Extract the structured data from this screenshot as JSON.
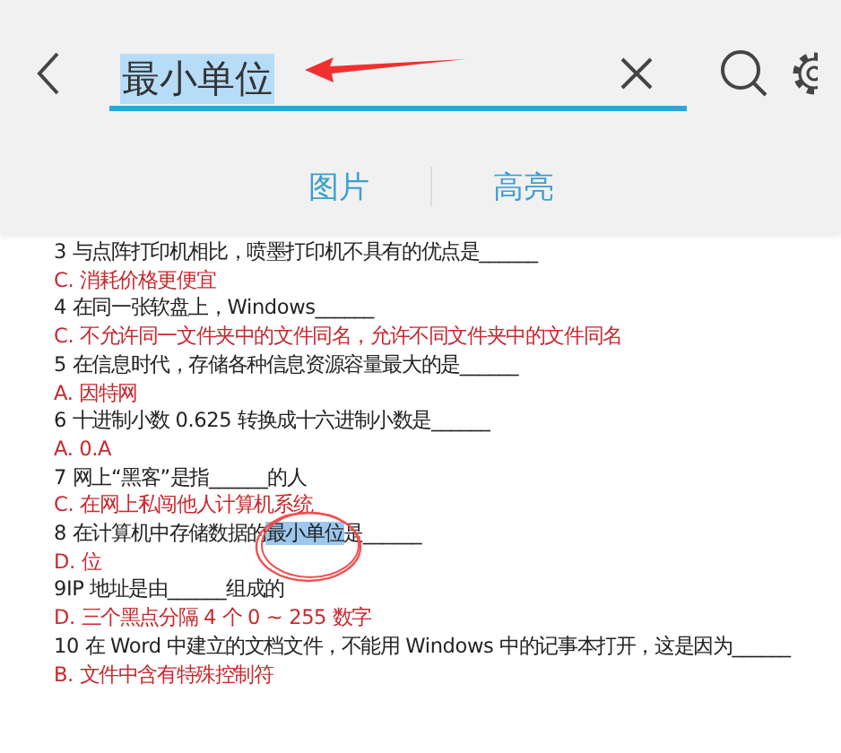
{
  "search": {
    "value": "最小单位",
    "selected_text": true
  },
  "tabs": [
    {
      "label": "图片",
      "selected": false
    },
    {
      "label": "高亮",
      "selected": false
    }
  ],
  "lines": [
    {
      "kind": "question",
      "parts": [
        {
          "text": "3 与点阵打印机相比，喷墨打印机不具有的优点是______",
          "highlighted": false
        }
      ]
    },
    {
      "kind": "answer",
      "parts": [
        {
          "text": "C. 消耗价格更便宜",
          "highlighted": false
        }
      ]
    },
    {
      "kind": "question",
      "parts": [
        {
          "text": "4 在同一张软盘上，Windows______",
          "highlighted": false
        }
      ]
    },
    {
      "kind": "answer",
      "parts": [
        {
          "text": "C. 不允许同一文件夹中的文件同名，允许不同文件夹中的文件同名",
          "highlighted": false
        }
      ]
    },
    {
      "kind": "question",
      "parts": [
        {
          "text": "5 在信息时代，存储各种信息资源容量最大的是______",
          "highlighted": false
        }
      ]
    },
    {
      "kind": "answer",
      "parts": [
        {
          "text": "A. 因特网",
          "highlighted": false
        }
      ]
    },
    {
      "kind": "question",
      "parts": [
        {
          "text": "6 十进制小数 0.625 转换成十六进制小数是______",
          "highlighted": false
        }
      ]
    },
    {
      "kind": "answer",
      "parts": [
        {
          "text": "A. 0.A",
          "highlighted": false
        }
      ]
    },
    {
      "kind": "question",
      "parts": [
        {
          "text": "7 网上“黑客”是指______的人",
          "highlighted": false
        }
      ]
    },
    {
      "kind": "answer",
      "parts": [
        {
          "text": "C. 在网上私闯他人计算机系统",
          "highlighted": false
        }
      ]
    },
    {
      "kind": "question",
      "parts": [
        {
          "text": "8 在计算机中存储数据的",
          "highlighted": false
        },
        {
          "text": "最小单位",
          "highlighted": true
        },
        {
          "text": "是______",
          "highlighted": false
        }
      ]
    },
    {
      "kind": "answer",
      "parts": [
        {
          "text": "D. 位",
          "highlighted": false
        }
      ]
    },
    {
      "kind": "question",
      "parts": [
        {
          "text": "9IP 地址是由______组成的",
          "highlighted": false
        }
      ]
    },
    {
      "kind": "answer",
      "parts": [
        {
          "text": "D. 三个黑点分隔 4 个 0 ~ 255 数字",
          "highlighted": false
        }
      ]
    },
    {
      "kind": "question",
      "parts": [
        {
          "text": "10 在 Word 中建立的文档文件，不能用 Windows 中的记事本打开，这是因为______",
          "highlighted": false
        }
      ]
    },
    {
      "kind": "answer",
      "parts": [
        {
          "text": "B. 文件中含有特殊控制符",
          "highlighted": false
        }
      ]
    }
  ]
}
